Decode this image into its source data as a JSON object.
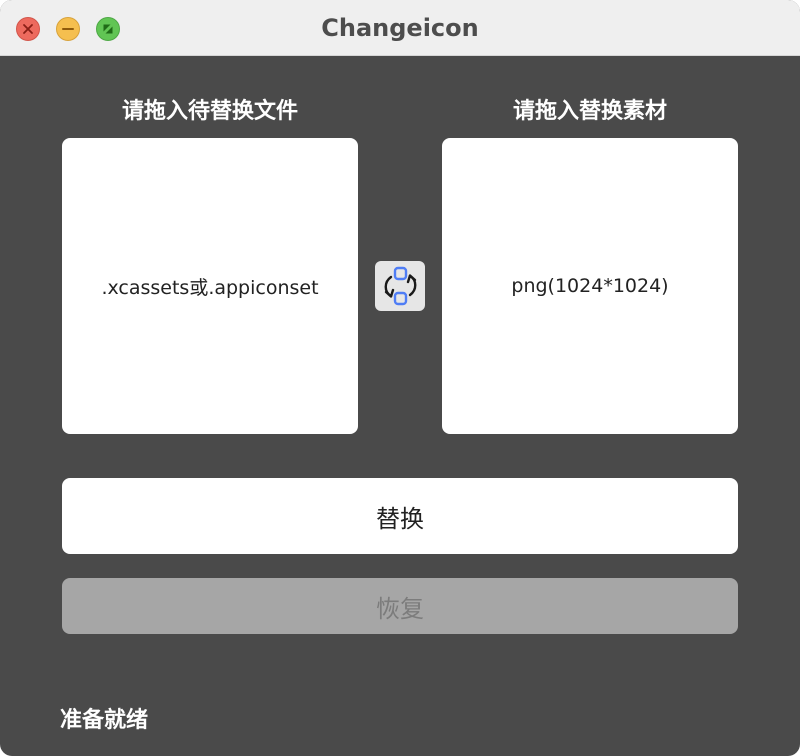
{
  "window": {
    "title": "Changeicon"
  },
  "source": {
    "label": "请拖入待替换文件",
    "hint": ".xcassets或.appiconset"
  },
  "material": {
    "label": "请拖入替换素材",
    "hint": "png(1024*1024)"
  },
  "swap": {
    "icon": "swap-icon"
  },
  "actions": {
    "replace_label": "替换",
    "restore_label": "恢复"
  },
  "status": {
    "text": "准备就绪"
  },
  "colors": {
    "background": "#4a4a4a",
    "titlebar": "#efefef",
    "close": "#ed6a5e",
    "minimize": "#f5bf4f",
    "maximize": "#61c554",
    "swap_accent": "#4f7df5",
    "disabled_button": "#a6a6a6"
  }
}
